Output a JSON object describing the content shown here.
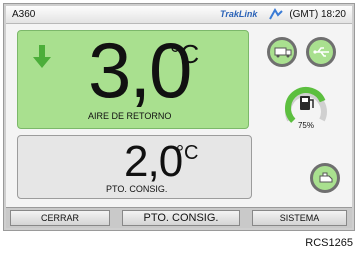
{
  "statusbar": {
    "unit_id": "A360",
    "brand": "TrakLink",
    "clock": "(GMT) 18:20"
  },
  "return_air": {
    "value": "3,0",
    "unit": "°C",
    "label": "AIRE DE RETORNO"
  },
  "setpoint": {
    "value": "2,0",
    "unit": "°C",
    "label": "PTO. CONSIG."
  },
  "fuel": {
    "level_percent": 75,
    "label": "75%"
  },
  "softkeys": {
    "close": "CERRAR",
    "setpoint": "PTO. CONSIG.",
    "system": "SISTEMA"
  },
  "caption": "RCS1265",
  "colors": {
    "accent_green": "#a9e08f",
    "panel_gray": "#e6e6e6"
  }
}
